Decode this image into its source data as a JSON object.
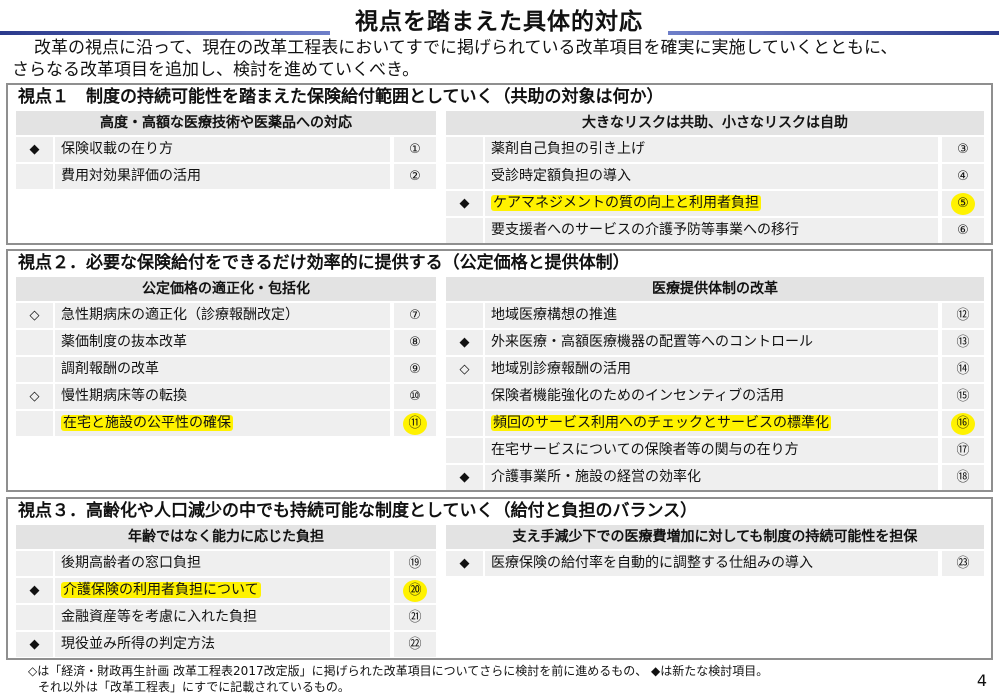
{
  "title": "視点を踏まえた具体的対応",
  "intro": {
    "line1": "改革の視点に沿って、現在の改革工程表においてすでに掲げられている改革項目を確実に実施していくとともに、",
    "line2": "さらなる改革項目を追加し、検討を進めていくべき。"
  },
  "view1": {
    "title": "視点１　制度の持続可能性を踏まえた保険給付範囲としていく（共助の対象は何か）",
    "left": {
      "header": "高度・高額な医療技術や医薬品への対応",
      "rows": [
        {
          "mark": "◆",
          "text": "保険収載の在り方",
          "num": "①",
          "highlight": false
        },
        {
          "mark": "",
          "text": "費用対効果評価の活用",
          "num": "②",
          "highlight": false
        }
      ]
    },
    "right": {
      "header": "大きなリスクは共助、小さなリスクは自助",
      "rows": [
        {
          "mark": "",
          "text": "薬剤自己負担の引き上げ",
          "num": "③",
          "highlight": false
        },
        {
          "mark": "",
          "text": "受診時定額負担の導入",
          "num": "④",
          "highlight": false
        },
        {
          "mark": "◆",
          "text": "ケアマネジメントの質の向上と利用者負担",
          "num": "⑤",
          "highlight": true
        },
        {
          "mark": "",
          "text": "要支援者へのサービスの介護予防等事業への移行",
          "num": "⑥",
          "highlight": false
        }
      ]
    }
  },
  "view2": {
    "title": "視点２．必要な保険給付をできるだけ効率的に提供する（公定価格と提供体制）",
    "left": {
      "header": "公定価格の適正化・包括化",
      "rows": [
        {
          "mark": "◇",
          "text": "急性期病床の適正化（診療報酬改定）",
          "num": "⑦",
          "highlight": false
        },
        {
          "mark": "",
          "text": "薬価制度の抜本改革",
          "num": "⑧",
          "highlight": false
        },
        {
          "mark": "",
          "text": "調剤報酬の改革",
          "num": "⑨",
          "highlight": false
        },
        {
          "mark": "◇",
          "text": "慢性期病床等の転換",
          "num": "⑩",
          "highlight": false
        },
        {
          "mark": "",
          "text": "在宅と施設の公平性の確保",
          "num": "⑪",
          "highlight": true
        }
      ]
    },
    "right": {
      "header": "医療提供体制の改革",
      "rows": [
        {
          "mark": "",
          "text": "地域医療構想の推進",
          "num": "⑫",
          "highlight": false
        },
        {
          "mark": "◆",
          "text": "外来医療・高額医療機器の配置等へのコントロール",
          "num": "⑬",
          "highlight": false
        },
        {
          "mark": "◇",
          "text": "地域別診療報酬の活用",
          "num": "⑭",
          "highlight": false
        },
        {
          "mark": "",
          "text": "保険者機能強化のためのインセンティブの活用",
          "num": "⑮",
          "highlight": false
        },
        {
          "mark": "",
          "text": "頻回のサービス利用へのチェックとサービスの標準化",
          "num": "⑯",
          "highlight": true
        },
        {
          "mark": "",
          "text": "在宅サービスについての保険者等の関与の在り方",
          "num": "⑰",
          "highlight": false
        },
        {
          "mark": "◆",
          "text": "介護事業所・施設の経営の効率化",
          "num": "⑱",
          "highlight": false
        }
      ]
    }
  },
  "view3": {
    "title": "視点３．高齢化や人口減少の中でも持続可能な制度としていく（給付と負担のバランス）",
    "left": {
      "header": "年齢ではなく能力に応じた負担",
      "rows": [
        {
          "mark": "",
          "text": "後期高齢者の窓口負担",
          "num": "⑲",
          "highlight": false
        },
        {
          "mark": "◆",
          "text": "介護保険の利用者負担について",
          "num": "⑳",
          "highlight": true
        },
        {
          "mark": "",
          "text": "金融資産等を考慮に入れた負担",
          "num": "㉑",
          "highlight": false
        },
        {
          "mark": "◆",
          "text": "現役並み所得の判定方法",
          "num": "㉒",
          "highlight": false
        }
      ]
    },
    "right": {
      "header": "支え手減少下での医療費増加に対しても制度の持続可能性を担保",
      "rows": [
        {
          "mark": "◆",
          "text": "医療保険の給付率を自動的に調整する仕組みの導入",
          "num": "㉓",
          "highlight": false
        }
      ]
    }
  },
  "footnote": {
    "line1": "◇は「経済・財政再生計画 改革工程表2017改定版」に掲げられた改革項目についてさらに検討を前に進めるもの、 ◆は新たな検討項目。",
    "line2": "それ以外は「改革工程表」にすでに記載されているもの。"
  },
  "page_number": "4",
  "colors": {
    "highlight": "#fff200",
    "title_bar": "#2b3a8c",
    "cell_bg": "#efefef",
    "header_bg": "#e3e3e3",
    "panel_border": "#8f8f8f"
  }
}
